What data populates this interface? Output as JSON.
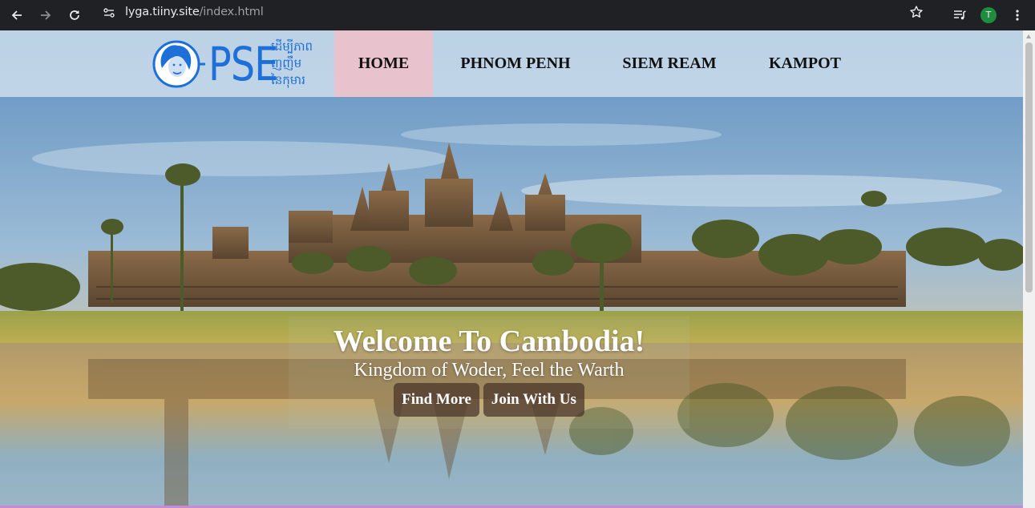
{
  "browser": {
    "url_host": "lyga.tiiny.site",
    "url_path": "/index.html",
    "profile_initial": "T",
    "icons": [
      "back-arrow-icon",
      "forward-arrow-icon",
      "reload-icon",
      "site-info-icon",
      "star-icon",
      "media-controls-icon",
      "kebab-menu-icon"
    ]
  },
  "header": {
    "logo_text": "PSE",
    "logo_khmer_lines": [
      "ដើម្បីភាព",
      "ញញឹម",
      "នៃកុមារ"
    ],
    "menu": [
      {
        "label": "HOME",
        "active": true
      },
      {
        "label": "PHNOM PENH",
        "active": false
      },
      {
        "label": "SIEM REAM",
        "active": false
      },
      {
        "label": "KAMPOT",
        "active": false
      }
    ],
    "active_color": "#e8c3cd"
  },
  "hero": {
    "title": "Welcome To Cambodia!",
    "subtitle": "Kingdom of Woder, Feel the Warth",
    "buttons": [
      {
        "label": "Find More"
      },
      {
        "label": "Join With Us"
      }
    ]
  },
  "colors": {
    "logo_blue": "#1e6fd8",
    "bottom_accent": "#c58ad8"
  }
}
